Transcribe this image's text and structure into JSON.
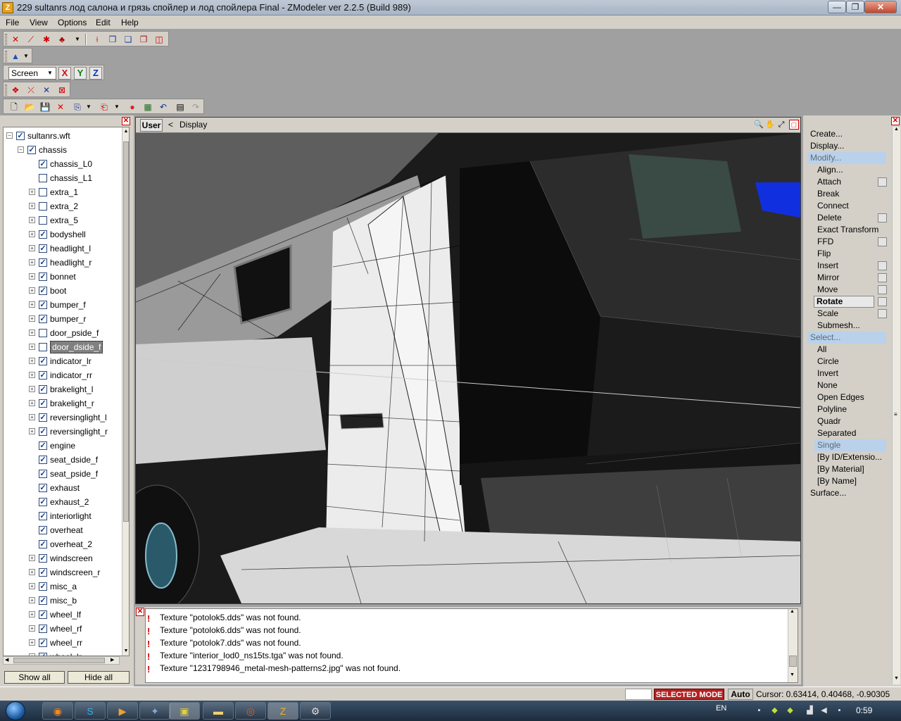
{
  "window": {
    "title": "229 sultanrs лод салона и грязь спойлер и лод спойлера Final - ZModeler ver 2.2.5 (Build 989)",
    "app_icon": "Z",
    "min_glyph": "—",
    "max_glyph": "❐",
    "close_glyph": "✕"
  },
  "menu": [
    "File",
    "View",
    "Options",
    "Edit",
    "Help"
  ],
  "toolbar": {
    "coord_system": "Screen",
    "axis_x": "X",
    "axis_y": "Y",
    "axis_z": "Z"
  },
  "tree": {
    "nodes": [
      {
        "label": "sultanrs.wft",
        "checked": true,
        "level": 0,
        "expander": "-"
      },
      {
        "label": "chassis",
        "checked": true,
        "level": 1,
        "expander": "-"
      },
      {
        "label": "chassis_L0",
        "checked": true,
        "level": 2,
        "expander": ""
      },
      {
        "label": "chassis_L1",
        "checked": false,
        "level": 2,
        "expander": ""
      },
      {
        "label": "extra_1",
        "checked": false,
        "level": 2,
        "expander": "+"
      },
      {
        "label": "extra_2",
        "checked": false,
        "level": 2,
        "expander": "+"
      },
      {
        "label": "extra_5",
        "checked": false,
        "level": 2,
        "expander": "+"
      },
      {
        "label": "bodyshell",
        "checked": true,
        "level": 2,
        "expander": "+"
      },
      {
        "label": "headlight_l",
        "checked": true,
        "level": 2,
        "expander": "+"
      },
      {
        "label": "headlight_r",
        "checked": true,
        "level": 2,
        "expander": "+"
      },
      {
        "label": "bonnet",
        "checked": true,
        "level": 2,
        "expander": "+"
      },
      {
        "label": "boot",
        "checked": true,
        "level": 2,
        "expander": "+"
      },
      {
        "label": "bumper_f",
        "checked": true,
        "level": 2,
        "expander": "+"
      },
      {
        "label": "bumper_r",
        "checked": true,
        "level": 2,
        "expander": "+"
      },
      {
        "label": "door_pside_f",
        "checked": false,
        "level": 2,
        "expander": "+"
      },
      {
        "label": "door_dside_f",
        "checked": false,
        "level": 2,
        "expander": "+",
        "selected": true
      },
      {
        "label": "indicator_lr",
        "checked": true,
        "level": 2,
        "expander": "+"
      },
      {
        "label": "indicator_rr",
        "checked": true,
        "level": 2,
        "expander": "+"
      },
      {
        "label": "brakelight_l",
        "checked": true,
        "level": 2,
        "expander": "+"
      },
      {
        "label": "brakelight_r",
        "checked": true,
        "level": 2,
        "expander": "+"
      },
      {
        "label": "reversinglight_l",
        "checked": true,
        "level": 2,
        "expander": "+"
      },
      {
        "label": "reversinglight_r",
        "checked": true,
        "level": 2,
        "expander": "+"
      },
      {
        "label": "engine",
        "checked": true,
        "level": 2,
        "expander": ""
      },
      {
        "label": "seat_dside_f",
        "checked": true,
        "level": 2,
        "expander": ""
      },
      {
        "label": "seat_pside_f",
        "checked": true,
        "level": 2,
        "expander": ""
      },
      {
        "label": "exhaust",
        "checked": true,
        "level": 2,
        "expander": ""
      },
      {
        "label": "exhaust_2",
        "checked": true,
        "level": 2,
        "expander": ""
      },
      {
        "label": "interiorlight",
        "checked": true,
        "level": 2,
        "expander": ""
      },
      {
        "label": "overheat",
        "checked": true,
        "level": 2,
        "expander": ""
      },
      {
        "label": "overheat_2",
        "checked": true,
        "level": 2,
        "expander": ""
      },
      {
        "label": "windscreen",
        "checked": true,
        "level": 2,
        "expander": "+"
      },
      {
        "label": "windscreen_r",
        "checked": true,
        "level": 2,
        "expander": "+"
      },
      {
        "label": "misc_a",
        "checked": true,
        "level": 2,
        "expander": "+"
      },
      {
        "label": "misc_b",
        "checked": true,
        "level": 2,
        "expander": "+"
      },
      {
        "label": "wheel_lf",
        "checked": true,
        "level": 2,
        "expander": "+"
      },
      {
        "label": "wheel_rf",
        "checked": true,
        "level": 2,
        "expander": "+"
      },
      {
        "label": "wheel_rr",
        "checked": true,
        "level": 2,
        "expander": "+"
      },
      {
        "label": "wheel_lr",
        "checked": true,
        "level": 2,
        "expander": "+"
      }
    ],
    "show_all": "Show all",
    "hide_all": "Hide all"
  },
  "viewport": {
    "view_name": "User",
    "mode_arrow": "<",
    "mode_label": "Display"
  },
  "log": {
    "lines": [
      "Texture \"potolok5.dds\" was not found.",
      "Texture \"potolok6.dds\" was not found.",
      "Texture \"potolok7.dds\" was not found.",
      "Texture \"interior_lod0_ns15ts.tga\" was not found.",
      "Texture \"1231798946_metal-mesh-patterns2.jpg\" was not found."
    ]
  },
  "commands": [
    {
      "label": "Create...",
      "kind": "hdr"
    },
    {
      "label": "Display...",
      "kind": "hdr"
    },
    {
      "label": "Modify...",
      "kind": "hdr-hi"
    },
    {
      "label": "Align...",
      "kind": "sub",
      "box": false
    },
    {
      "label": "Attach",
      "kind": "sub",
      "box": true
    },
    {
      "label": "Break",
      "kind": "sub",
      "box": false
    },
    {
      "label": "Connect",
      "kind": "sub",
      "box": false
    },
    {
      "label": "Delete",
      "kind": "sub",
      "box": true
    },
    {
      "label": "Exact Transform",
      "kind": "sub",
      "box": false
    },
    {
      "label": "FFD",
      "kind": "sub",
      "box": true
    },
    {
      "label": "Flip",
      "kind": "sub",
      "box": false
    },
    {
      "label": "Insert",
      "kind": "sub",
      "box": true
    },
    {
      "label": "Mirror",
      "kind": "sub",
      "box": true
    },
    {
      "label": "Move",
      "kind": "sub",
      "box": true
    },
    {
      "label": "Rotate",
      "kind": "sub-bold",
      "box": true
    },
    {
      "label": "Scale",
      "kind": "sub",
      "box": true
    },
    {
      "label": "Submesh...",
      "kind": "sub",
      "box": false
    },
    {
      "label": "Select...",
      "kind": "hdr-hi"
    },
    {
      "label": "All",
      "kind": "sub",
      "box": false
    },
    {
      "label": "Circle",
      "kind": "sub",
      "box": false
    },
    {
      "label": "Invert",
      "kind": "sub",
      "box": false
    },
    {
      "label": "None",
      "kind": "sub",
      "box": false
    },
    {
      "label": "Open Edges",
      "kind": "sub",
      "box": false
    },
    {
      "label": "Polyline",
      "kind": "sub",
      "box": false
    },
    {
      "label": "Quadr",
      "kind": "sub",
      "box": false
    },
    {
      "label": "Separated",
      "kind": "sub",
      "box": false
    },
    {
      "label": "Single",
      "kind": "sub-hi",
      "box": false
    },
    {
      "label": "[By ID/Extensio...",
      "kind": "sub",
      "box": false
    },
    {
      "label": "[By Material]",
      "kind": "sub",
      "box": false
    },
    {
      "label": "[By Name]",
      "kind": "sub",
      "box": false
    },
    {
      "label": "Surface...",
      "kind": "hdr"
    }
  ],
  "status": {
    "mode": "SELECTED MODE",
    "auto": "Auto",
    "cursor": "Cursor: 0.63414, 0.40468, -0.90305"
  },
  "taskbar": {
    "lang": "EN",
    "clock": "0:59"
  }
}
